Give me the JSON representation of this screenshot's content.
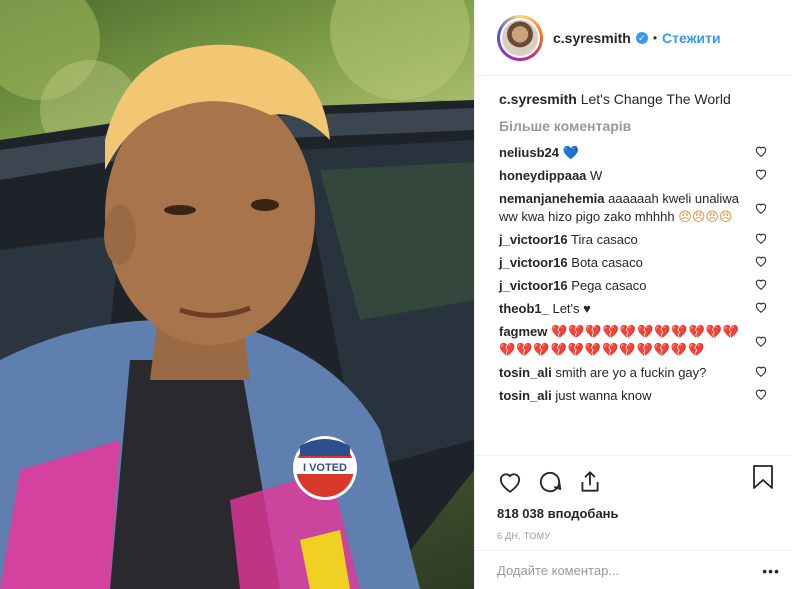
{
  "post": {
    "username": "c.syresmith",
    "follow_label": "Стежити",
    "dot": "•",
    "verified_mark": "✓",
    "caption_user": "c.syresmith",
    "caption_text": "Let's Change The World",
    "more_comments": "Більше коментарів"
  },
  "comments": [
    {
      "user": "neliusb24",
      "text": "",
      "emoji": "💙"
    },
    {
      "user": "honeydippaaa",
      "text": "W",
      "emoji": ""
    },
    {
      "user": "nemanjanehemia",
      "text": "aaaaaah kweli unaliwa ww kwa hizo pigo zako mhhhh",
      "emoji": "😠😠😠😠"
    },
    {
      "user": "j_victoor16",
      "text": "Tira casaco",
      "emoji": ""
    },
    {
      "user": "j_victoor16",
      "text": "Bota casaco",
      "emoji": ""
    },
    {
      "user": "j_victoor16",
      "text": "Pega casaco",
      "emoji": ""
    },
    {
      "user": "theob1_",
      "text": "Let's ♥",
      "emoji": ""
    },
    {
      "user": "fagmew",
      "text": "",
      "emoji": "💔💔💔💔💔💔💔💔💔💔💔💔💔💔💔💔💔💔💔💔💔💔💔"
    },
    {
      "user": "tosin_ali",
      "text": "smith are yo a fuckin gay?",
      "emoji": ""
    },
    {
      "user": "tosin_ali",
      "text": "just wanna know",
      "emoji": ""
    }
  ],
  "stats": {
    "likes": "818 038 вподобань",
    "time_ago": "6 ДН. ТОМУ"
  },
  "add_comment": {
    "placeholder": "Додайте коментар...",
    "more": "•••"
  },
  "photo": {
    "sticker_text": "I VOTED"
  },
  "icons": {
    "like": "heart-outline-icon",
    "comment": "comment-bubble-icon",
    "share": "share-icon",
    "save": "bookmark-icon",
    "verified": "verified-badge-icon"
  },
  "colors": {
    "link": "#3897f0",
    "muted": "#999999",
    "text": "#262626"
  }
}
